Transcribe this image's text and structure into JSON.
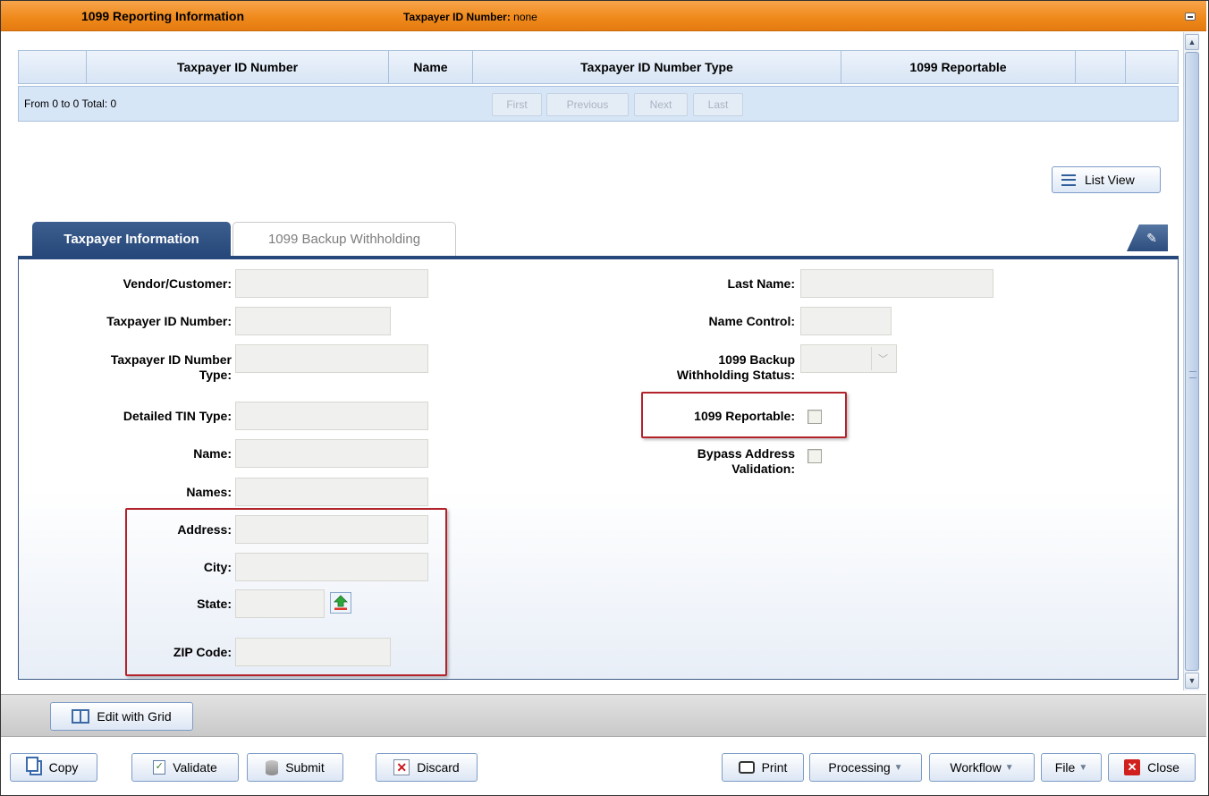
{
  "titlebar": {
    "title": "1099 Reporting Information",
    "tin_label": "Taxpayer ID Number:",
    "tin_value": "none"
  },
  "grid": {
    "columns": [
      "",
      "Taxpayer ID Number",
      "Name",
      "Taxpayer ID Number Type",
      "1099 Reportable",
      "",
      ""
    ],
    "range_text": "From 0 to 0 Total: 0",
    "pager": {
      "first": "First",
      "previous": "Previous",
      "next": "Next",
      "last": "Last"
    }
  },
  "list_view_label": "List View",
  "tabs": {
    "active": "Taxpayer Information",
    "inactive": "1099 Backup Withholding"
  },
  "form": {
    "vendor_customer": {
      "label": "Vendor/Customer:",
      "value": ""
    },
    "taxpayer_id_number": {
      "label": "Taxpayer ID Number:",
      "value": ""
    },
    "taxpayer_id_number_type": {
      "label": "Taxpayer ID Number Type:",
      "value": ""
    },
    "detailed_tin_type": {
      "label": "Detailed TIN Type:",
      "value": ""
    },
    "name": {
      "label": "Name:",
      "value": ""
    },
    "names": {
      "label": "Names:",
      "value": ""
    },
    "address": {
      "label": "Address:",
      "value": ""
    },
    "city": {
      "label": "City:",
      "value": ""
    },
    "state": {
      "label": "State:",
      "value": ""
    },
    "zip_code": {
      "label": "ZIP Code:",
      "value": ""
    },
    "last_name": {
      "label": "Last Name:",
      "value": ""
    },
    "name_control": {
      "label": "Name Control:",
      "value": ""
    },
    "backup_withholding_status": {
      "label_line1": "1099 Backup",
      "label_line2": "Withholding Status:",
      "value": ""
    },
    "reportable_1099": {
      "label": "1099 Reportable:",
      "checked": false
    },
    "bypass_address_validation": {
      "label_line1": "Bypass Address",
      "label_line2": "Validation:",
      "checked": false
    }
  },
  "edit_bar": {
    "edit_with_grid": "Edit with Grid"
  },
  "actions": {
    "copy": "Copy",
    "validate": "Validate",
    "submit": "Submit",
    "discard": "Discard",
    "print": "Print",
    "processing": "Processing",
    "workflow": "Workflow",
    "file": "File",
    "close": "Close"
  },
  "colors": {
    "titlebar": "#f08a1c",
    "tab_active": "#27487a",
    "highlight_box": "#b3232b",
    "grid_header": "#d8e5f5"
  }
}
